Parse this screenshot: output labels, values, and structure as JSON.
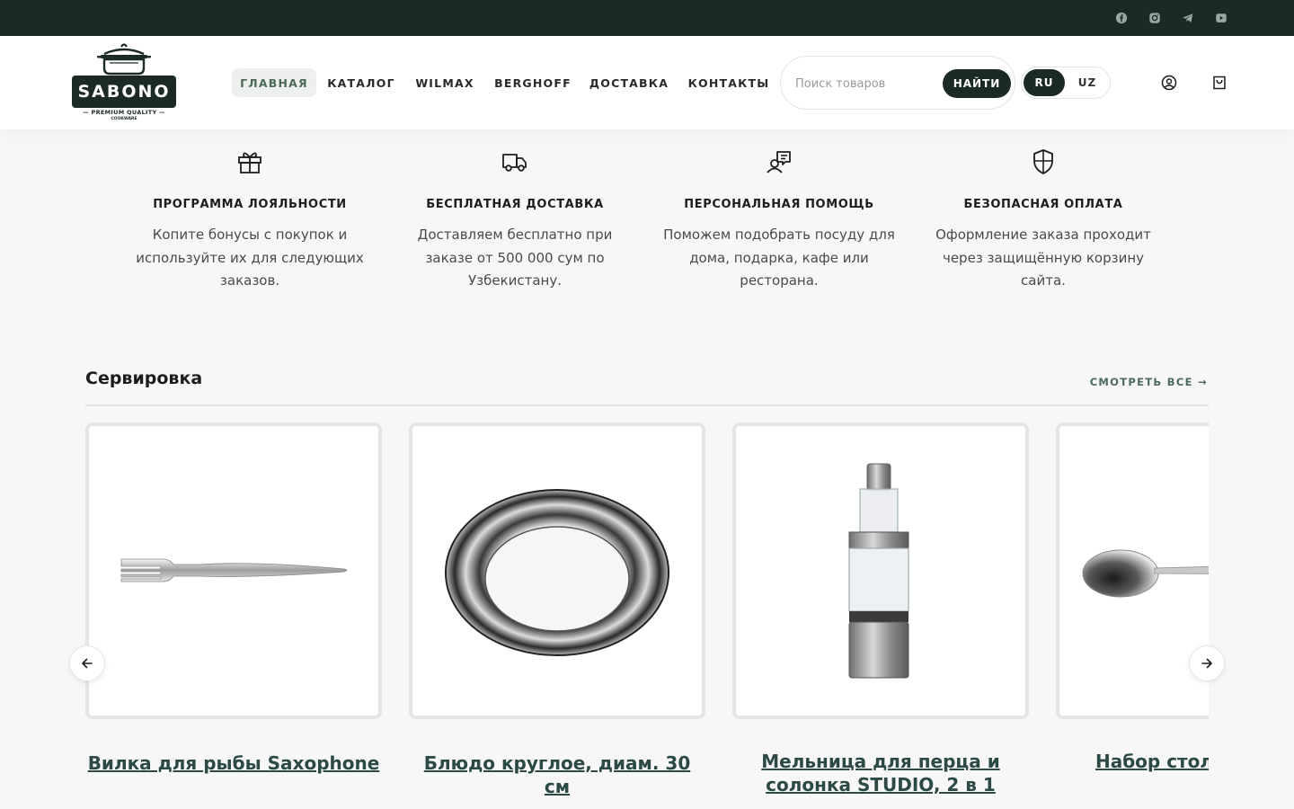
{
  "topbar": {
    "socials": [
      {
        "icon": "facebook-icon"
      },
      {
        "icon": "instagram-icon"
      },
      {
        "icon": "telegram-icon"
      },
      {
        "icon": "youtube-icon"
      }
    ]
  },
  "header": {
    "logo": {
      "brand": "SABONO",
      "tagline": "— PREMIUM QUALITY —",
      "sub": "COOKWARE"
    },
    "nav": [
      {
        "label": "ГЛАВНАЯ",
        "active": true
      },
      {
        "label": "КАТАЛОГ"
      },
      {
        "label": "WILMAX"
      },
      {
        "label": "BERGHOFF"
      },
      {
        "label": "ДОСТАВКА"
      },
      {
        "label": "КОНТАКТЫ"
      }
    ],
    "search": {
      "placeholder": "Поиск товаров",
      "button": "НАЙТИ"
    },
    "lang": {
      "ru": "RU",
      "uz": "UZ",
      "active": "RU"
    }
  },
  "features": [
    {
      "icon": "gift-icon",
      "title": "ПРОГРАММА ЛОЯЛЬНОСТИ",
      "text": "Копите бонусы с покупок и используйте их для следующих заказов."
    },
    {
      "icon": "truck-icon",
      "title": "БЕСПЛАТНАЯ ДОСТАВКА",
      "text": "Доставляем бесплатно при заказе от 500 000 сум по Узбекистану."
    },
    {
      "icon": "support-chat-icon",
      "title": "ПЕРСОНАЛЬНАЯ ПОМОЩЬ",
      "text": "Поможем подобрать посуду для дома, подарка, кафе или ресторана."
    },
    {
      "icon": "shield-icon",
      "title": "БЕЗОПАСНАЯ ОПЛАТА",
      "text": "Оформление заказа проходит через защищённую корзину сайта."
    }
  ],
  "section": {
    "title": "Сервировка",
    "see_all": "СМОТРЕТЬ ВСЕ →",
    "products": [
      {
        "title": "Вилка для рыбы Saxophone",
        "image": "fork"
      },
      {
        "title": "Блюдо круглое, диам. 30 см",
        "image": "round-dish"
      },
      {
        "title": "Мельница для перца и солонка STUDIO, 2 в 1",
        "image": "pepper-mill"
      },
      {
        "title": "Набор столо Quadro,",
        "image": "spoon"
      }
    ]
  },
  "colors": {
    "accent": "#1c2a24",
    "link": "#2c4a45",
    "muted_green": "#4b6a5c"
  }
}
